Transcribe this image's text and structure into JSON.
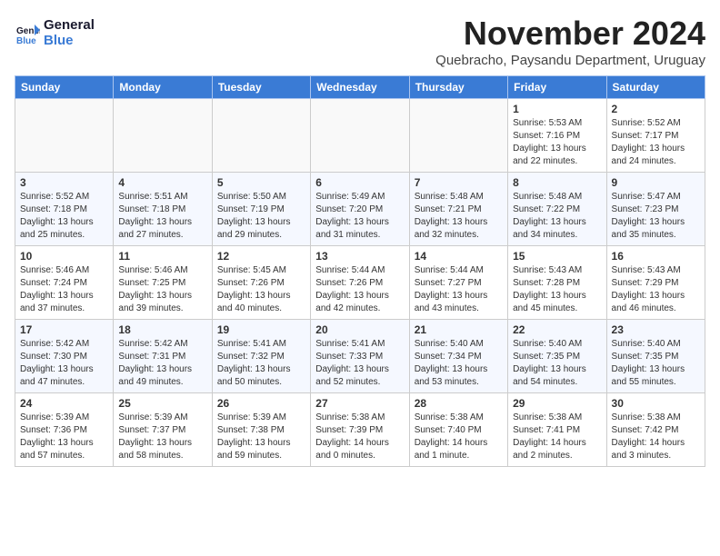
{
  "header": {
    "logo_line1": "General",
    "logo_line2": "Blue",
    "month_title": "November 2024",
    "subtitle": "Quebracho, Paysandu Department, Uruguay"
  },
  "weekdays": [
    "Sunday",
    "Monday",
    "Tuesday",
    "Wednesday",
    "Thursday",
    "Friday",
    "Saturday"
  ],
  "weeks": [
    [
      {
        "day": "",
        "info": ""
      },
      {
        "day": "",
        "info": ""
      },
      {
        "day": "",
        "info": ""
      },
      {
        "day": "",
        "info": ""
      },
      {
        "day": "",
        "info": ""
      },
      {
        "day": "1",
        "info": "Sunrise: 5:53 AM\nSunset: 7:16 PM\nDaylight: 13 hours\nand 22 minutes."
      },
      {
        "day": "2",
        "info": "Sunrise: 5:52 AM\nSunset: 7:17 PM\nDaylight: 13 hours\nand 24 minutes."
      }
    ],
    [
      {
        "day": "3",
        "info": "Sunrise: 5:52 AM\nSunset: 7:18 PM\nDaylight: 13 hours\nand 25 minutes."
      },
      {
        "day": "4",
        "info": "Sunrise: 5:51 AM\nSunset: 7:18 PM\nDaylight: 13 hours\nand 27 minutes."
      },
      {
        "day": "5",
        "info": "Sunrise: 5:50 AM\nSunset: 7:19 PM\nDaylight: 13 hours\nand 29 minutes."
      },
      {
        "day": "6",
        "info": "Sunrise: 5:49 AM\nSunset: 7:20 PM\nDaylight: 13 hours\nand 31 minutes."
      },
      {
        "day": "7",
        "info": "Sunrise: 5:48 AM\nSunset: 7:21 PM\nDaylight: 13 hours\nand 32 minutes."
      },
      {
        "day": "8",
        "info": "Sunrise: 5:48 AM\nSunset: 7:22 PM\nDaylight: 13 hours\nand 34 minutes."
      },
      {
        "day": "9",
        "info": "Sunrise: 5:47 AM\nSunset: 7:23 PM\nDaylight: 13 hours\nand 35 minutes."
      }
    ],
    [
      {
        "day": "10",
        "info": "Sunrise: 5:46 AM\nSunset: 7:24 PM\nDaylight: 13 hours\nand 37 minutes."
      },
      {
        "day": "11",
        "info": "Sunrise: 5:46 AM\nSunset: 7:25 PM\nDaylight: 13 hours\nand 39 minutes."
      },
      {
        "day": "12",
        "info": "Sunrise: 5:45 AM\nSunset: 7:26 PM\nDaylight: 13 hours\nand 40 minutes."
      },
      {
        "day": "13",
        "info": "Sunrise: 5:44 AM\nSunset: 7:26 PM\nDaylight: 13 hours\nand 42 minutes."
      },
      {
        "day": "14",
        "info": "Sunrise: 5:44 AM\nSunset: 7:27 PM\nDaylight: 13 hours\nand 43 minutes."
      },
      {
        "day": "15",
        "info": "Sunrise: 5:43 AM\nSunset: 7:28 PM\nDaylight: 13 hours\nand 45 minutes."
      },
      {
        "day": "16",
        "info": "Sunrise: 5:43 AM\nSunset: 7:29 PM\nDaylight: 13 hours\nand 46 minutes."
      }
    ],
    [
      {
        "day": "17",
        "info": "Sunrise: 5:42 AM\nSunset: 7:30 PM\nDaylight: 13 hours\nand 47 minutes."
      },
      {
        "day": "18",
        "info": "Sunrise: 5:42 AM\nSunset: 7:31 PM\nDaylight: 13 hours\nand 49 minutes."
      },
      {
        "day": "19",
        "info": "Sunrise: 5:41 AM\nSunset: 7:32 PM\nDaylight: 13 hours\nand 50 minutes."
      },
      {
        "day": "20",
        "info": "Sunrise: 5:41 AM\nSunset: 7:33 PM\nDaylight: 13 hours\nand 52 minutes."
      },
      {
        "day": "21",
        "info": "Sunrise: 5:40 AM\nSunset: 7:34 PM\nDaylight: 13 hours\nand 53 minutes."
      },
      {
        "day": "22",
        "info": "Sunrise: 5:40 AM\nSunset: 7:35 PM\nDaylight: 13 hours\nand 54 minutes."
      },
      {
        "day": "23",
        "info": "Sunrise: 5:40 AM\nSunset: 7:35 PM\nDaylight: 13 hours\nand 55 minutes."
      }
    ],
    [
      {
        "day": "24",
        "info": "Sunrise: 5:39 AM\nSunset: 7:36 PM\nDaylight: 13 hours\nand 57 minutes."
      },
      {
        "day": "25",
        "info": "Sunrise: 5:39 AM\nSunset: 7:37 PM\nDaylight: 13 hours\nand 58 minutes."
      },
      {
        "day": "26",
        "info": "Sunrise: 5:39 AM\nSunset: 7:38 PM\nDaylight: 13 hours\nand 59 minutes."
      },
      {
        "day": "27",
        "info": "Sunrise: 5:38 AM\nSunset: 7:39 PM\nDaylight: 14 hours\nand 0 minutes."
      },
      {
        "day": "28",
        "info": "Sunrise: 5:38 AM\nSunset: 7:40 PM\nDaylight: 14 hours\nand 1 minute."
      },
      {
        "day": "29",
        "info": "Sunrise: 5:38 AM\nSunset: 7:41 PM\nDaylight: 14 hours\nand 2 minutes."
      },
      {
        "day": "30",
        "info": "Sunrise: 5:38 AM\nSunset: 7:42 PM\nDaylight: 14 hours\nand 3 minutes."
      }
    ]
  ]
}
